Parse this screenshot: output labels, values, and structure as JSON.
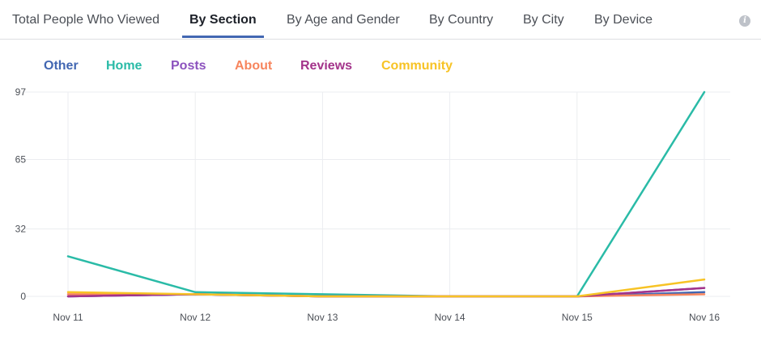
{
  "tabs": [
    {
      "label": "Total People Who Viewed",
      "active": false
    },
    {
      "label": "By Section",
      "active": true
    },
    {
      "label": "By Age and Gender",
      "active": false
    },
    {
      "label": "By Country",
      "active": false
    },
    {
      "label": "By City",
      "active": false
    },
    {
      "label": "By Device",
      "active": false
    }
  ],
  "info_icon": {
    "glyph": "i",
    "icon": "info-icon"
  },
  "chart_data": {
    "type": "line",
    "title": "",
    "xlabel": "",
    "ylabel": "",
    "x": [
      "Nov 11",
      "Nov 12",
      "Nov 13",
      "Nov 14",
      "Nov 15",
      "Nov 16"
    ],
    "yticks": [
      0,
      32,
      65,
      97
    ],
    "ylim": [
      0,
      97
    ],
    "grid": true,
    "legend_position": "top-left",
    "series": [
      {
        "name": "Other",
        "color": "#4267b2",
        "values": [
          0,
          1,
          0,
          0,
          0,
          2
        ]
      },
      {
        "name": "Home",
        "color": "#2abba7",
        "values": [
          19,
          2,
          1,
          0,
          0,
          97
        ]
      },
      {
        "name": "Posts",
        "color": "#8c52be",
        "values": [
          0,
          1,
          0,
          0,
          0,
          4
        ]
      },
      {
        "name": "About",
        "color": "#f7855d",
        "values": [
          1,
          1,
          0,
          0,
          0,
          1
        ]
      },
      {
        "name": "Reviews",
        "color": "#a3338a",
        "values": [
          0,
          1,
          0,
          0,
          0,
          4
        ]
      },
      {
        "name": "Community",
        "color": "#f7c325",
        "values": [
          2,
          1,
          0,
          0,
          0,
          8
        ]
      }
    ]
  }
}
